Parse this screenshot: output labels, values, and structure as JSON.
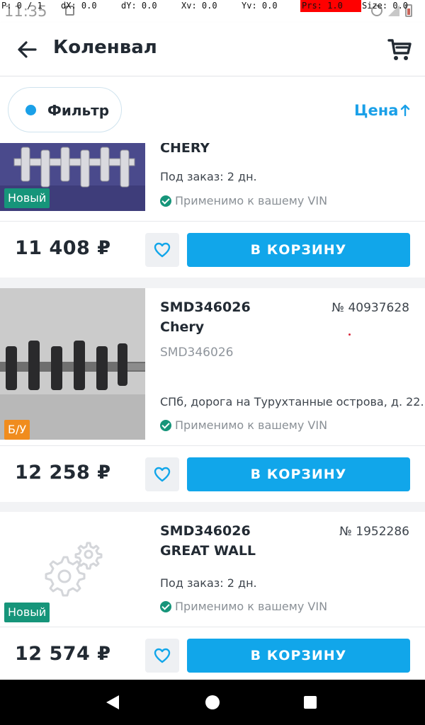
{
  "status": {
    "clock": "11:35"
  },
  "debug": {
    "p": "P: 0 / 1",
    "dx": "dX: 0.0",
    "dy": "dY: 0.0",
    "xv": "Xv: 0.0",
    "yv": "Yv: 0.0",
    "prs": "Prs: 1.0",
    "size": "Size: 0.0"
  },
  "header": {
    "title": "Коленвал",
    "back_icon": "arrow-left-icon",
    "cart_icon": "cart-icon"
  },
  "filterbar": {
    "filter_label": "Фильтр",
    "sort_label": "Цена",
    "accent": "#1aa0e8"
  },
  "items": [
    {
      "brand": "CHERY",
      "order": "Под заказ: 2 дн.",
      "vin": "Применимо к вашему VIN",
      "badge": "Новый",
      "price": "11 408 ₽",
      "cart_label": "В КОРЗИНУ"
    },
    {
      "article": "SMD346026",
      "number": "№ 40937628",
      "brand": "Chery",
      "sub": "SMD346026",
      "address": "СПб, дорога на Турухтанные острова, д. 22...",
      "vin": "Применимо к вашему VIN",
      "badge": "Б/У",
      "price": "12 258 ₽",
      "cart_label": "В КОРЗИНУ"
    },
    {
      "article": "SMD346026",
      "number": "№ 1952286",
      "brand": "GREAT WALL",
      "order": "Под заказ: 2 дн.",
      "vin": "Применимо к вашему VIN",
      "badge": "Новый",
      "price": "12 574 ₽",
      "cart_label": "В КОРЗИНУ"
    }
  ],
  "colors": {
    "new_badge": "#16957a",
    "used_badge": "#f08c1e",
    "cart_button": "#11a6ea"
  }
}
